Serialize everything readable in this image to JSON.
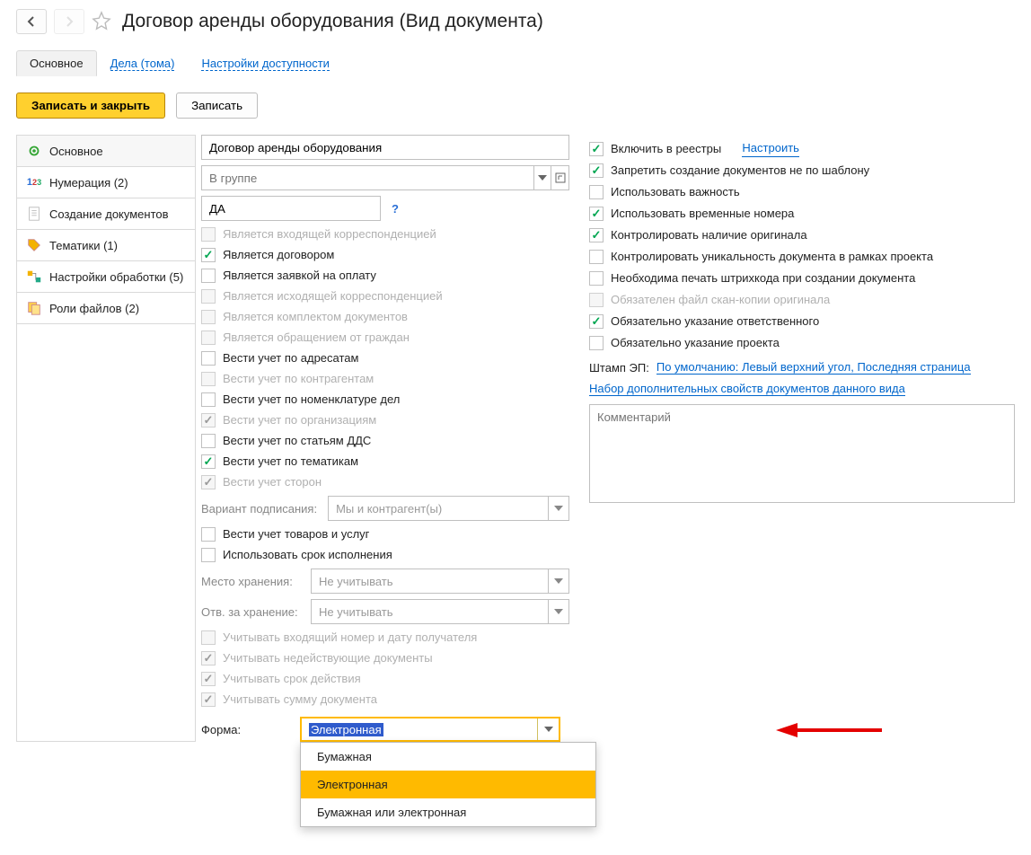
{
  "header": {
    "title": "Договор аренды оборудования (Вид документа)"
  },
  "tabs": {
    "main": "Основное",
    "cases": "Дела (тома)",
    "access": "Настройки доступности"
  },
  "actions": {
    "save_close": "Записать и закрыть",
    "save": "Записать"
  },
  "sidebar": {
    "items": [
      {
        "label": "Основное",
        "icon": "gear-icon"
      },
      {
        "label": "Нумерация (2)",
        "icon": "numbers-icon"
      },
      {
        "label": "Создание документов",
        "icon": "document-icon"
      },
      {
        "label": "Тематики (1)",
        "icon": "tag-icon"
      },
      {
        "label": "Настройки обработки (5)",
        "icon": "flow-icon"
      },
      {
        "label": "Роли файлов (2)",
        "icon": "files-icon"
      }
    ]
  },
  "left": {
    "name_value": "Договор аренды оборудования",
    "group_placeholder": "В группе",
    "code_value": "ДА",
    "checks": {
      "incoming": "Является входящей корреспонденцией",
      "contract": "Является договором",
      "payment": "Является заявкой на оплату",
      "outgoing": "Является исходящей корреспонденцией",
      "docset": "Является комплектом документов",
      "appeal": "Является обращением от граждан",
      "addressees": "Вести учет по адресатам",
      "counterparties": "Вести учет по контрагентам",
      "nomenclature": "Вести учет по номенклатуре дел",
      "organizations": "Вести учет по организациям",
      "dds": "Вести учет по статьям ДДС",
      "topics": "Вести учет по тематикам",
      "parties": "Вести учет сторон",
      "signing_label": "Вариант подписания:",
      "signing_value": "Мы и контрагент(ы)",
      "goods": "Вести учет товаров и услуг",
      "deadline": "Использовать срок исполнения",
      "storage_label": "Место хранения:",
      "storage_value": "Не учитывать",
      "resp_storage_label": "Отв. за хранение:",
      "resp_storage_value": "Не учитывать",
      "inc_number": "Учитывать входящий номер и дату получателя",
      "inactive_docs": "Учитывать недействующие документы",
      "validity": "Учитывать срок действия",
      "amount": "Учитывать сумму документа"
    },
    "form_label": "Форма:",
    "form_value": "Электронная",
    "form_options": [
      "Бумажная",
      "Электронная",
      "Бумажная или электронная"
    ]
  },
  "right": {
    "registries": "Включить в реестры",
    "configure": "Настроить",
    "forbid_no_template": "Запретить создание документов не по шаблону",
    "use_importance": "Использовать важность",
    "use_temp_numbers": "Использовать временные номера",
    "control_original": "Контролировать наличие оригинала",
    "control_unique": "Контролировать уникальность документа в рамках проекта",
    "need_barcode": "Необходима печать штрихкода при создании документа",
    "scan_required": "Обязателен файл скан-копии оригинала",
    "resp_required": "Обязательно указание ответственного",
    "project_required": "Обязательно указание проекта",
    "stamp_label": "Штамп ЭП:",
    "stamp_value": "По умолчанию: Левый верхний угол, Последняя страница",
    "extra_props": "Набор дополнительных свойств документов данного вида",
    "comment_placeholder": "Комментарий"
  }
}
